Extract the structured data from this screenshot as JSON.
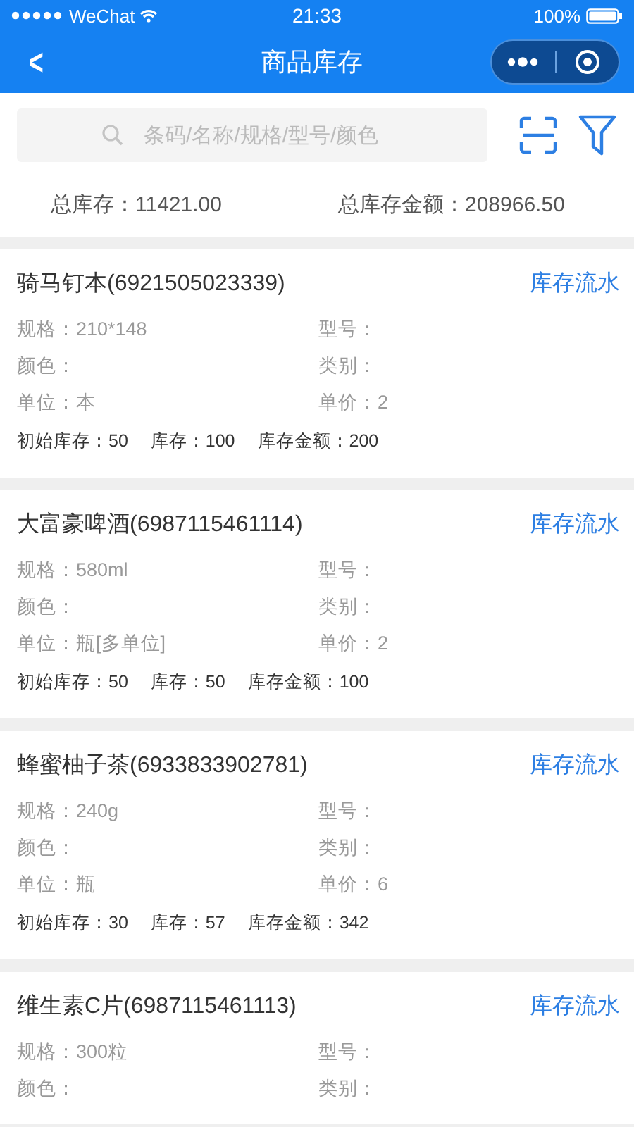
{
  "status_bar": {
    "carrier": "WeChat",
    "time": "21:33",
    "battery": "100%"
  },
  "nav": {
    "back": "<",
    "title": "商品库存"
  },
  "search": {
    "placeholder": "条码/名称/规格/型号/颜色"
  },
  "summary": [
    "总库存：11421.00",
    "总库存金额：208966.50"
  ],
  "products": [
    {
      "title": "骑马钉本(6921505023339)",
      "link": "库存流水",
      "fields": [
        "规格：210*148",
        "型号：",
        "颜色：",
        "类别：",
        "单位：本",
        "单价：2"
      ],
      "totals": [
        "初始库存：50",
        "库存：100",
        "库存金额：200"
      ]
    },
    {
      "title": "大富豪啤酒(6987115461114)",
      "link": "库存流水",
      "fields": [
        "规格：580ml",
        "型号：",
        "颜色：",
        "类别：",
        "单位：瓶[多单位]",
        "单价：2"
      ],
      "totals": [
        "初始库存：50",
        "库存：50",
        "库存金额：100"
      ]
    },
    {
      "title": "蜂蜜柚子茶(6933833902781)",
      "link": "库存流水",
      "fields": [
        "规格：240g",
        "型号：",
        "颜色：",
        "类别：",
        "单位：瓶",
        "单价：6"
      ],
      "totals": [
        "初始库存：30",
        "库存：57",
        "库存金额：342"
      ]
    },
    {
      "title": "维生素C片(6987115461113)",
      "link": "库存流水",
      "fields": [
        "规格：300粒",
        "型号：",
        "颜色：",
        "类别："
      ]
    }
  ]
}
